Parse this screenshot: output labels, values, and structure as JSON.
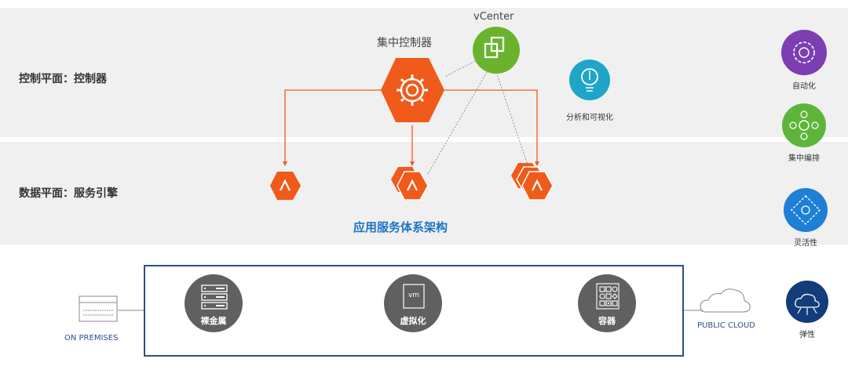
{
  "control_plane": {
    "label": "控制平面：控制器"
  },
  "data_plane": {
    "label": "数据平面：服务引擎"
  },
  "controller": {
    "title": "集中控制器"
  },
  "vcenter": {
    "label": "vCenter"
  },
  "analytics": {
    "label": "分析和可视化"
  },
  "architecture": {
    "title": "应用服务体系架构"
  },
  "features": [
    {
      "label": "自动化",
      "color": "#7b3fb3",
      "icon": "gear-icon"
    },
    {
      "label": "集中编排",
      "color": "#5eb53a",
      "icon": "orchestration-icon"
    },
    {
      "label": "灵活性",
      "color": "#1e7fd6",
      "icon": "diamond-icon"
    },
    {
      "label": "弹性",
      "color": "#123c7a",
      "icon": "elastic-cloud-icon"
    }
  ],
  "infrastructure": {
    "on_premises": "ON PREMISES",
    "public_cloud": "PUBLIC CLOUD",
    "items": [
      {
        "label": "裸金属",
        "icon": "server-icon"
      },
      {
        "label": "虚拟化",
        "icon": "vm-icon",
        "badge": "vm"
      },
      {
        "label": "容器",
        "icon": "container-icon"
      }
    ]
  },
  "colors": {
    "accent": "#f05a1a",
    "vcenter": "#6ab42d",
    "analytics": "#1ea5c8",
    "title_blue": "#1b74c6",
    "infra_border": "#2a4f8e"
  }
}
